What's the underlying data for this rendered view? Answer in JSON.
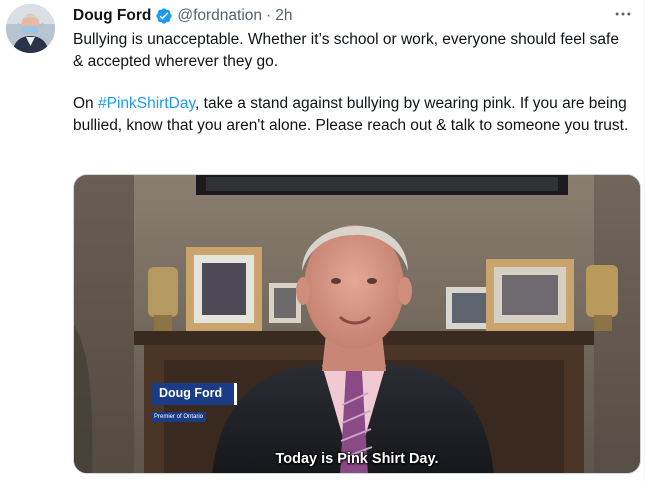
{
  "tweet": {
    "author_name": "Doug Ford",
    "handle": "@fordnation",
    "separator": "·",
    "timestamp": "2h",
    "more_icon": "more-horizontal-icon",
    "verified_icon": "verified-badge-icon",
    "paragraph1": "Bullying is unacceptable. Whether it’s school or work, everyone should feel safe & accepted wherever they go.",
    "paragraph2_prefix": "On ",
    "hashtag": "#PinkShirtDay",
    "paragraph2_suffix": ", take a stand against bullying by wearing pink. If you are being bullied, know that you aren't alone. Please reach out & talk to someone you trust."
  },
  "video": {
    "lower_third_name": "Doug Ford",
    "lower_third_title": "Premier of Ontario",
    "caption": "Today is Pink Shirt Day."
  },
  "colors": {
    "verified": "#1d9bf0",
    "hashtag": "#1d9bf0",
    "lower_third_bg": "#1b3b86"
  }
}
